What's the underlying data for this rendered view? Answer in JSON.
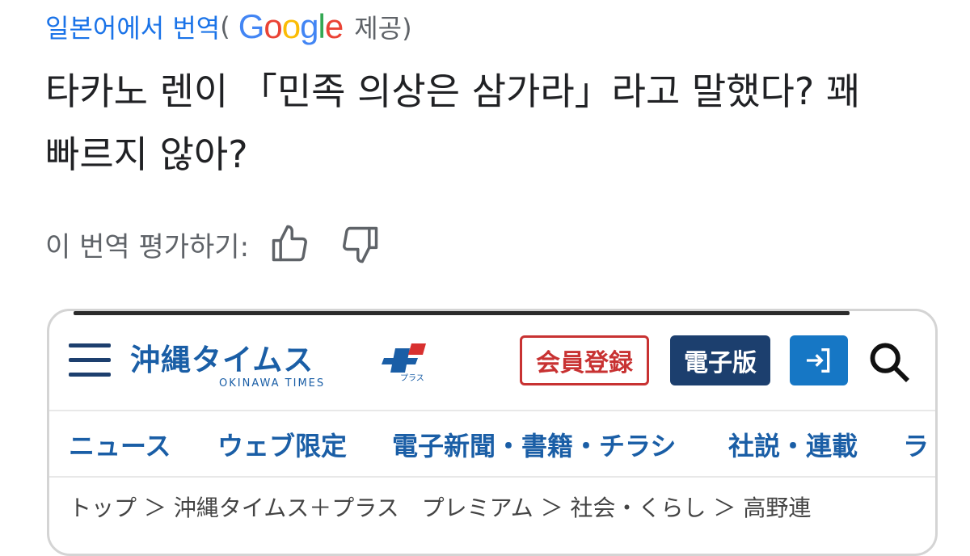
{
  "translation_bar": {
    "prefix": "일본어에서 번역",
    "open_paren": "(",
    "logo_letters": [
      "G",
      "o",
      "o",
      "g",
      "l",
      "e"
    ],
    "suffix": "제공)"
  },
  "translated_text": {
    "line1": "타카노 렌이 「민족 의상은 삼가라」라고 말했다? 꽤",
    "line2": "빠르지 않아?"
  },
  "rating": {
    "label": "이 번역 평가하기:",
    "thumbs_up_icon": "thumbs-up-icon",
    "thumbs_down_icon": "thumbs-down-icon"
  },
  "site": {
    "logo_text": "沖縄タイムス",
    "logo_sub": "OKINAWA TIMES",
    "logo_plus": "プラス",
    "member_button": "会員登録",
    "digital_button": "電子版",
    "login_symbol": "→]",
    "nav": [
      "ニュース",
      "ウェブ限定",
      "電子新聞・書籍・チラシ",
      "社説・連載",
      "ラ"
    ],
    "breadcrumb": "トップ ＞ 沖縄タイムス＋プラス　プレミアム ＞ 社会・くらし ＞ 高野連",
    "colors": {
      "brand_blue": "#1a5ea6",
      "navy": "#1c3f6e",
      "red": "#c83232",
      "login_blue": "#1677c5"
    }
  }
}
